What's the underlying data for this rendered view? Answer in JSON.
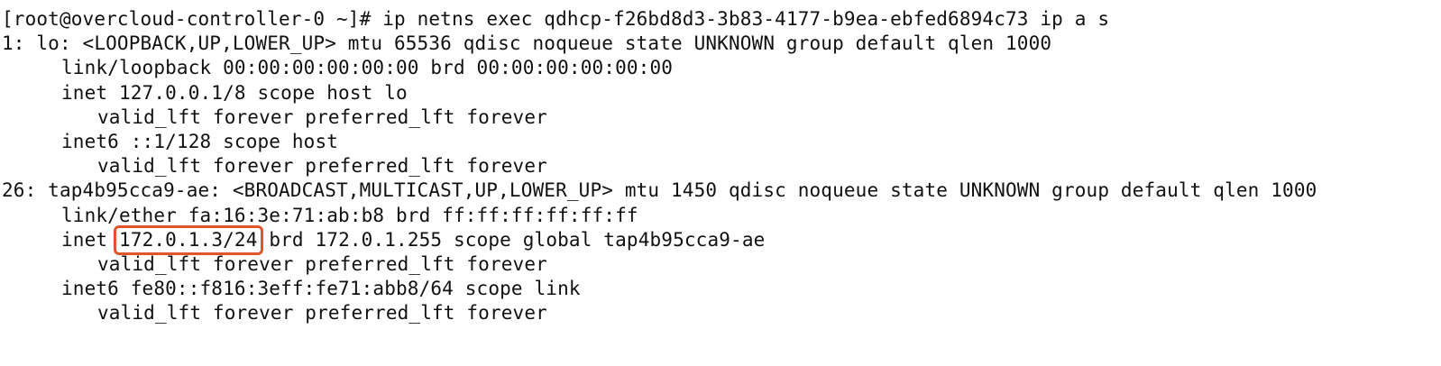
{
  "terminal": {
    "prompt": "[root@overcloud-controller-0 ~]#",
    "command": "ip netns exec qdhcp-f26bd8d3-3b83-4177-b9ea-ebfed6894c73 ip a s",
    "lines": {
      "l1": "1: lo: <LOOPBACK,UP,LOWER_UP> mtu 65536 qdisc noqueue state UNKNOWN group default qlen 1000",
      "l2": "link/loopback 00:00:00:00:00:00 brd 00:00:00:00:00:00",
      "l3": "inet 127.0.0.1/8 scope host lo",
      "l4": "valid_lft forever preferred_lft forever",
      "l5": "inet6 ::1/128 scope host",
      "l6": "valid_lft forever preferred_lft forever",
      "l7": "26: tap4b95cca9-ae: <BROADCAST,MULTICAST,UP,LOWER_UP> mtu 1450 qdisc noqueue state UNKNOWN group default qlen 1000",
      "l8": "link/ether fa:16:3e:71:ab:b8 brd ff:ff:ff:ff:ff:ff",
      "l9_prefix": "inet",
      "l9_highlight": "172.0.1.3/24",
      "l9_suffix": "brd 172.0.1.255 scope global tap4b95cca9-ae",
      "l10": "valid_lft forever preferred_lft forever",
      "l11": "inet6 fe80::f816:3eff:fe71:abb8/64 scope link",
      "l12": "valid_lft forever preferred_lft forever"
    }
  },
  "colors": {
    "text": "#111111",
    "background": "#ffffff",
    "highlight_border": "#e0562b"
  }
}
